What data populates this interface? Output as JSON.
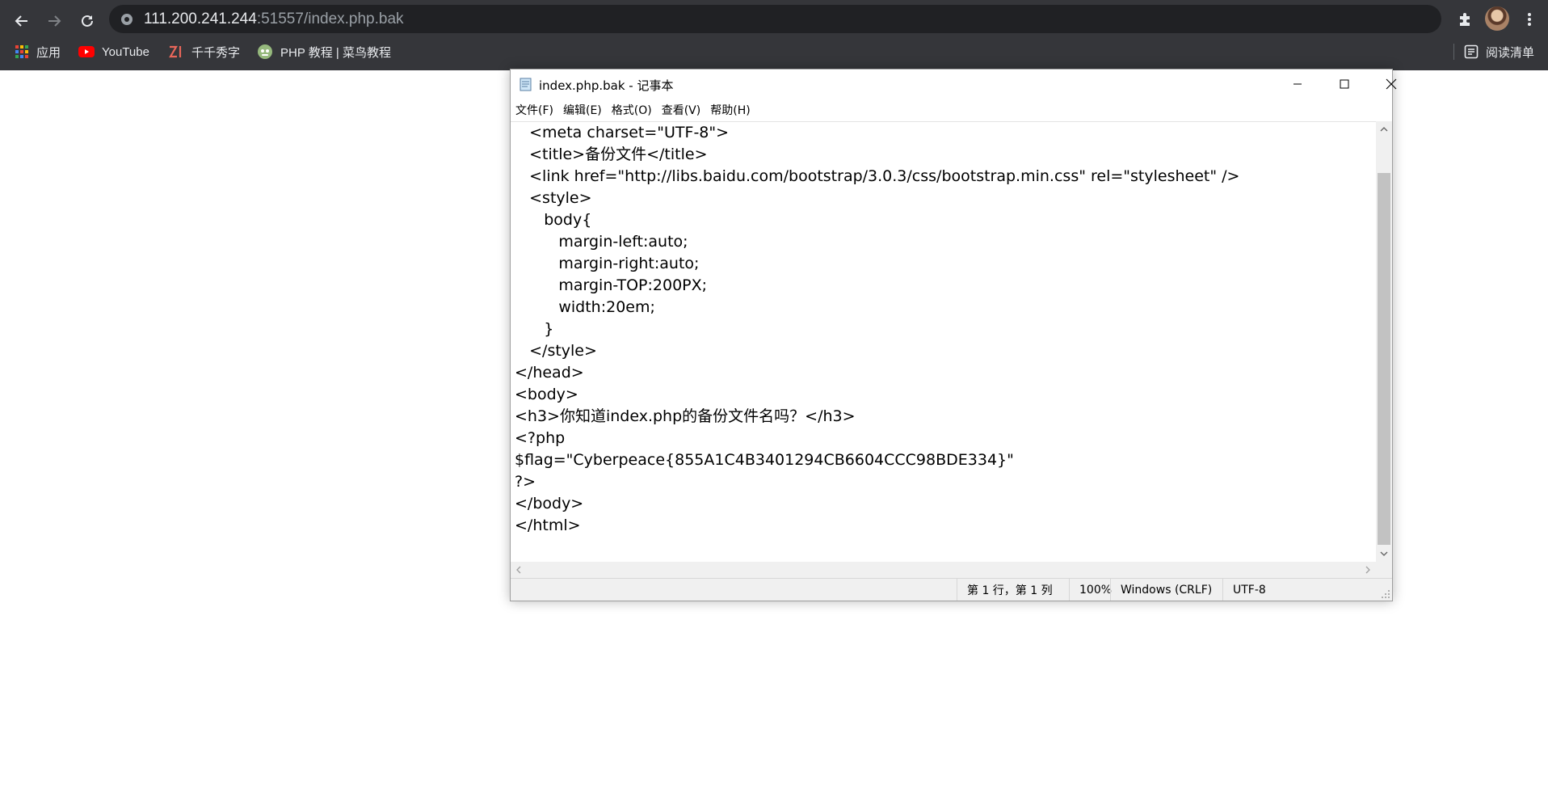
{
  "browser": {
    "address": {
      "host": "111.200.241.244",
      "rest": ":51557/index.php.bak"
    },
    "bookmarks": [
      {
        "label": "应用",
        "icon": "apps-grid-icon"
      },
      {
        "label": "YouTube",
        "icon": "youtube-icon"
      },
      {
        "label": "千千秀字",
        "icon": "zi-logo-icon"
      },
      {
        "label": "PHP 教程 | 菜鸟教程",
        "icon": "runoob-icon"
      }
    ],
    "reading_list": "阅读清单"
  },
  "notepad": {
    "title": "index.php.bak - 记事本",
    "menu": [
      "文件(F)",
      "编辑(E)",
      "格式(O)",
      "查看(V)",
      "帮助(H)"
    ],
    "lines": [
      "   <meta charset=\"UTF-8\">",
      "   <title>备份文件</title>",
      "   <link href=\"http://libs.baidu.com/bootstrap/3.0.3/css/bootstrap.min.css\" rel=\"stylesheet\" />",
      "   <style>",
      "      body{",
      "         margin-left:auto;",
      "         margin-right:auto;",
      "         margin-TOP:200PX;",
      "         width:20em;",
      "      }",
      "   </style>",
      "</head>",
      "<body>",
      "<h3>你知道index.php的备份文件名吗？</h3>",
      "<?php",
      "$flag=\"Cyberpeace{855A1C4B3401294CB6604CCC98BDE334}\"",
      "?>",
      "</body>",
      "</html>"
    ],
    "status": {
      "position": "第 1 行，第 1 列",
      "zoom": "100%",
      "line_ending": "Windows (CRLF)",
      "encoding": "UTF-8"
    }
  }
}
